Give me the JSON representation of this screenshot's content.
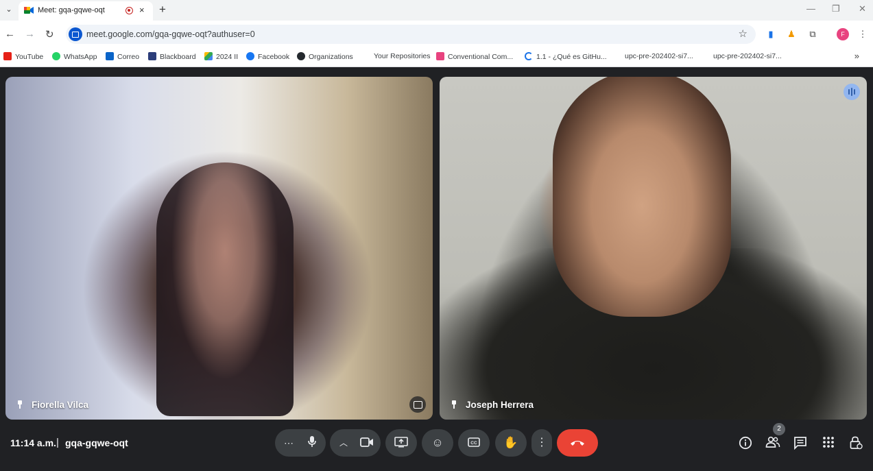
{
  "browser": {
    "tab_title": "Meet: gqa-gqwe-oqt",
    "new_tab_label": "+",
    "tab_close_label": "×",
    "url": "meet.google.com/gqa-gqwe-oqt?authuser=0",
    "profile_initial": "F",
    "window_controls": {
      "minimize": "—",
      "restore": "❐",
      "close": "✕"
    }
  },
  "bookmarks": [
    {
      "label": "YouTube",
      "icon": "youtube-icon",
      "color": "#e62117"
    },
    {
      "label": "WhatsApp",
      "icon": "whatsapp-icon",
      "color": "#25d366"
    },
    {
      "label": "Correo",
      "icon": "outlook-icon",
      "color": "#0a64c8"
    },
    {
      "label": "Blackboard",
      "icon": "blackboard-icon",
      "color": "#2c3e7a"
    },
    {
      "label": "2024 II",
      "icon": "drive-icon",
      "color": "#34a853"
    },
    {
      "label": "Facebook",
      "icon": "facebook-icon",
      "color": "#1877f2"
    },
    {
      "label": "Organizations",
      "icon": "github-icon",
      "color": "#24292e"
    },
    {
      "label": "Your Repositories",
      "icon": "",
      "color": ""
    },
    {
      "label": "Conventional Com...",
      "icon": "page-icon",
      "color": "#e8437f"
    },
    {
      "label": "1.1 - ¿Qué es GitHu...",
      "icon": "loading-icon",
      "color": "#1a73e8"
    },
    {
      "label": "upc-pre-202402-si7...",
      "icon": "",
      "color": ""
    },
    {
      "label": "upc-pre-202402-si7...",
      "icon": "",
      "color": ""
    }
  ],
  "meet": {
    "participants": [
      {
        "name": "Fiorella Vilca"
      },
      {
        "name": "Joseph Herrera"
      }
    ],
    "time": "11:14 a.m.",
    "separator": "|",
    "meeting_code": "gqa-gqwe-oqt",
    "participant_count": "2",
    "end_call_color": "#ea4335"
  }
}
